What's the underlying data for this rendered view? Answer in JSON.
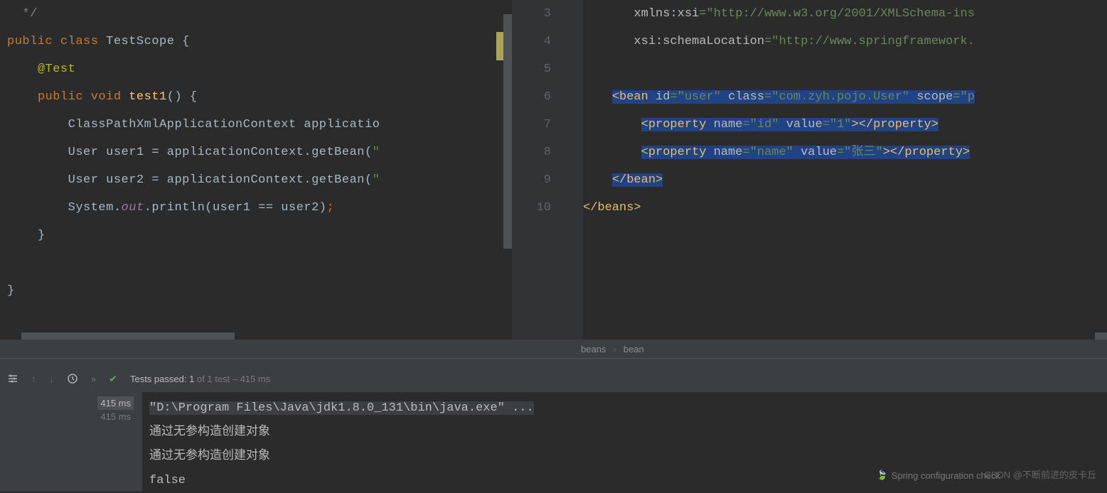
{
  "left_editor": {
    "lines": [
      {
        "indent": "  ",
        "tokens": [
          {
            "c": "comment",
            "t": "*/"
          }
        ]
      },
      {
        "indent": "",
        "tokens": [
          {
            "c": "kw-orange",
            "t": "public class "
          },
          {
            "c": "cls-name",
            "t": "TestScope {"
          }
        ]
      },
      {
        "indent": "    ",
        "tokens": [
          {
            "c": "kw-yellow",
            "t": "@Test"
          }
        ]
      },
      {
        "indent": "    ",
        "tokens": [
          {
            "c": "kw-orange",
            "t": "public void "
          },
          {
            "c": "method-name",
            "t": "test1"
          },
          {
            "c": "cls-name",
            "t": "() {"
          }
        ]
      },
      {
        "indent": "        ",
        "tokens": [
          {
            "c": "cls-name",
            "t": "ClassPathXmlApplicationContext applicatio"
          }
        ]
      },
      {
        "indent": "        ",
        "tokens": [
          {
            "c": "cls-name",
            "t": "User user1 = applicationContext.getBean("
          },
          {
            "c": "string",
            "t": "\""
          }
        ]
      },
      {
        "indent": "        ",
        "tokens": [
          {
            "c": "cls-name",
            "t": "User user2 = applicationContext.getBean("
          },
          {
            "c": "string",
            "t": "\""
          }
        ]
      },
      {
        "indent": "        ",
        "tokens": [
          {
            "c": "cls-name",
            "t": "System."
          },
          {
            "c": "field",
            "t": "out"
          },
          {
            "c": "cls-name",
            "t": ".println(user1 == user2)"
          },
          {
            "c": "kw-orange",
            "t": ";"
          }
        ]
      },
      {
        "indent": "    ",
        "tokens": [
          {
            "c": "cls-name",
            "t": "}"
          }
        ]
      },
      {
        "indent": "",
        "tokens": [
          {
            "c": "cls-name",
            "t": ""
          }
        ]
      },
      {
        "indent": "",
        "tokens": [
          {
            "c": "cls-name",
            "t": "}"
          }
        ]
      }
    ]
  },
  "right_editor": {
    "line_numbers": [
      "3",
      "4",
      "5",
      "6",
      "7",
      "8",
      "9",
      "10"
    ],
    "lines": [
      {
        "sel": false,
        "indent": "       ",
        "tokens": [
          {
            "c": "attr-name",
            "t": "xmlns"
          },
          {
            "c": "cls-name",
            "t": ":"
          },
          {
            "c": "attr-name",
            "t": "xsi"
          },
          {
            "c": "string",
            "t": "=\"http://www.w3.org/2001/XMLSchema-ins"
          }
        ]
      },
      {
        "sel": false,
        "indent": "       ",
        "tokens": [
          {
            "c": "attr-name",
            "t": "xsi"
          },
          {
            "c": "cls-name",
            "t": ":"
          },
          {
            "c": "attr-name",
            "t": "schemaLocation"
          },
          {
            "c": "string",
            "t": "=\"http://www.springframework."
          }
        ]
      },
      {
        "sel": false,
        "indent": "",
        "tokens": []
      },
      {
        "sel": true,
        "indent": "    ",
        "tokens": [
          {
            "c": "tag",
            "t": "<bean "
          },
          {
            "c": "attr-name",
            "t": "id"
          },
          {
            "c": "string",
            "t": "=\"user\" "
          },
          {
            "c": "attr-name",
            "t": "class"
          },
          {
            "c": "string",
            "t": "=\"com.zyh.pojo.User\" "
          },
          {
            "c": "attr-name",
            "t": "scope"
          },
          {
            "c": "string",
            "t": "=\"p"
          }
        ]
      },
      {
        "sel": true,
        "indent": "        ",
        "tokens": [
          {
            "c": "tag",
            "t": "<property "
          },
          {
            "c": "attr-name",
            "t": "name"
          },
          {
            "c": "string",
            "t": "=\"id\" "
          },
          {
            "c": "attr-name",
            "t": "value"
          },
          {
            "c": "string",
            "t": "=\"1\""
          },
          {
            "c": "tag",
            "t": "></property>"
          }
        ]
      },
      {
        "sel": true,
        "indent": "        ",
        "tokens": [
          {
            "c": "tag",
            "t": "<property "
          },
          {
            "c": "attr-name",
            "t": "name"
          },
          {
            "c": "string",
            "t": "=\"name\" "
          },
          {
            "c": "attr-name",
            "t": "value"
          },
          {
            "c": "string",
            "t": "=\"张三\""
          },
          {
            "c": "tag",
            "t": "></property>"
          }
        ]
      },
      {
        "sel": true,
        "indent": "    ",
        "tokens": [
          {
            "c": "tag",
            "t": "</bean>"
          }
        ]
      },
      {
        "sel": false,
        "indent": "",
        "tokens": [
          {
            "c": "tag",
            "t": "</beans>"
          }
        ]
      }
    ]
  },
  "breadcrumb": {
    "item1": "beans",
    "item2": "bean"
  },
  "test_toolbar": {
    "status_prefix": "Tests passed: 1",
    "status_suffix": " of 1 test – 415 ms"
  },
  "test_tree": {
    "t1": "415 ms",
    "t2": "415 ms"
  },
  "console": {
    "cmd": "\"D:\\Program Files\\Java\\jdk1.8.0_131\\bin\\java.exe\" ...",
    "l1": "通过无参构造创建对象",
    "l2": "通过无参构造创建对象",
    "l3": "false"
  },
  "watermark": "CSDN @不断前进的皮卡丘",
  "spring_status": "Spring configuration check"
}
